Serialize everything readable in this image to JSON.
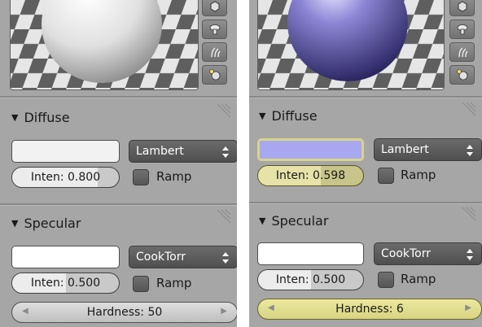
{
  "panels": [
    {
      "diffuse": {
        "title": "Diffuse",
        "color": "#f2f2f2",
        "shader": "Lambert",
        "intensity_label": "Inten: 0.800",
        "intensity_value": 0.8,
        "ramp_label": "Ramp"
      },
      "specular": {
        "title": "Specular",
        "color": "#ffffff",
        "shader": "CookTorr",
        "intensity_label": "Inten: 0.500",
        "intensity_value": 0.5,
        "ramp_label": "Ramp",
        "hardness_label": "Hardness: 50"
      },
      "sphere_color": "#e8e8e8"
    },
    {
      "diffuse": {
        "title": "Diffuse",
        "color": "#a8a8f0",
        "shader": "Lambert",
        "intensity_label": "Inten: 0.598",
        "intensity_value": 0.598,
        "ramp_label": "Ramp"
      },
      "specular": {
        "title": "Specular",
        "color": "#ffffff",
        "shader": "CookTorr",
        "intensity_label": "Inten: 0.500",
        "intensity_value": 0.5,
        "ramp_label": "Ramp",
        "hardness_label": "Hardness: 6"
      },
      "sphere_color": "#7a72c4"
    }
  ],
  "preview_buttons": [
    "cube-icon",
    "monkey-icon",
    "hair-icon",
    "sphere-world-icon"
  ]
}
